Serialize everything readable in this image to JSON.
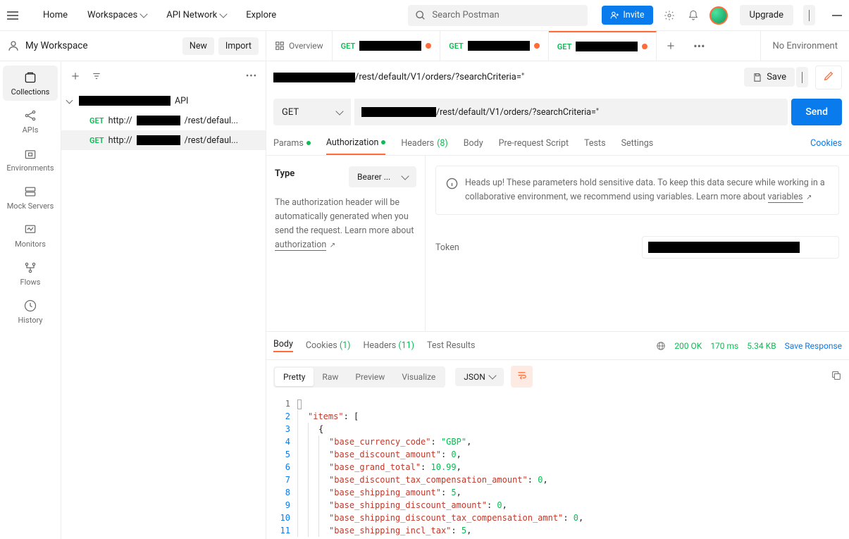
{
  "nav": {
    "home": "Home",
    "workspaces": "Workspaces",
    "apiNetwork": "API Network",
    "explore": "Explore",
    "searchPlaceholder": "Search Postman",
    "invite": "Invite",
    "upgrade": "Upgrade"
  },
  "workspace": {
    "name": "My Workspace",
    "new": "New",
    "import": "Import"
  },
  "tabs": {
    "overview": "Overview",
    "method": "GET",
    "noEnv": "No Environment"
  },
  "iconbar": {
    "collections": "Collections",
    "apis": "APIs",
    "environments": "Environments",
    "mockServers": "Mock Servers",
    "monitors": "Monitors",
    "flows": "Flows",
    "history": "History"
  },
  "tree": {
    "collectionSuffix": " API",
    "itemPrefix": "http://",
    "itemSuffix": "/rest/defaul..."
  },
  "breadcrumb": {
    "suffix": "/rest/default/V1/orders/?searchCriteria=\"",
    "save": "Save"
  },
  "url": {
    "method": "GET",
    "suffix": "/rest/default/V1/orders/?searchCriteria=\"",
    "send": "Send"
  },
  "reqTabs": {
    "params": "Params",
    "auth": "Authorization",
    "headers": "Headers",
    "headersCount": "(8)",
    "body": "Body",
    "prereq": "Pre-request Script",
    "tests": "Tests",
    "settings": "Settings",
    "cookies": "Cookies"
  },
  "auth": {
    "typeLabel": "Type",
    "typeValue": "Bearer ...",
    "desc1": "The authorization header will be automatically generated when you send the request. Learn more about ",
    "descLink": "authorization",
    "warn": "Heads up! These parameters hold sensitive data. To keep this data secure while working in a collaborative environment, we recommend using variables. Learn more about ",
    "warnLink": "variables",
    "tokenLabel": "Token"
  },
  "respTabs": {
    "body": "Body",
    "cookies": "Cookies",
    "cookiesCount": "(1)",
    "headers": "Headers",
    "headersCount": "(11)",
    "tests": "Test Results",
    "status": "200 OK",
    "time": "170 ms",
    "size": "5.34 KB",
    "save": "Save Response"
  },
  "viewTabs": {
    "pretty": "Pretty",
    "raw": "Raw",
    "preview": "Preview",
    "visualize": "Visualize",
    "json": "JSON"
  },
  "json": {
    "items": "items",
    "lines": [
      {
        "key": "base_currency_code",
        "val": "\"GBP\"",
        "type": "str"
      },
      {
        "key": "base_discount_amount",
        "val": "0",
        "type": "num"
      },
      {
        "key": "base_grand_total",
        "val": "10.99",
        "type": "num"
      },
      {
        "key": "base_discount_tax_compensation_amount",
        "val": "0",
        "type": "num"
      },
      {
        "key": "base_shipping_amount",
        "val": "5",
        "type": "num"
      },
      {
        "key": "base_shipping_discount_amount",
        "val": "0",
        "type": "num"
      },
      {
        "key": "base_shipping_discount_tax_compensation_amnt",
        "val": "0",
        "type": "num"
      },
      {
        "key": "base_shipping_incl_tax",
        "val": "5",
        "type": "num"
      }
    ]
  }
}
